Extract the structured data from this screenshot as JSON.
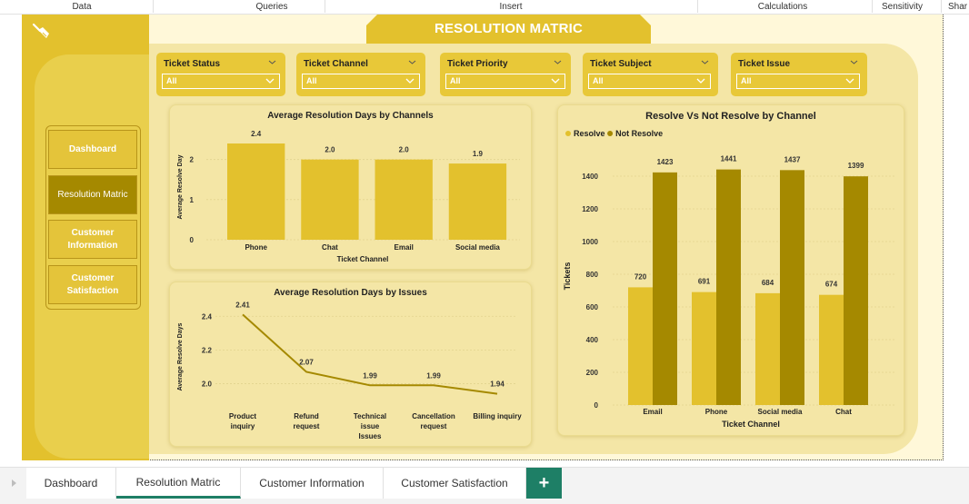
{
  "ribbon": {
    "items": [
      "Data",
      "Queries",
      "Insert",
      "Calculations",
      "Sensitivity",
      "Shar"
    ]
  },
  "page": {
    "title": "RESOLUTION MATRIC",
    "colors": {
      "gold": "#e3c12d",
      "dark_gold": "#a58900",
      "panel": "#f4e6a6",
      "accent_tab": "#1e7f66"
    }
  },
  "nav": {
    "items": [
      {
        "label": "Dashboard",
        "active": false
      },
      {
        "label": "Resolution Matric",
        "active": true
      },
      {
        "label": "Customer Information",
        "active": false
      },
      {
        "label": "Customer Satisfaction",
        "active": false
      }
    ]
  },
  "filters": [
    {
      "label": "Ticket Status",
      "value": "All"
    },
    {
      "label": "Ticket Channel",
      "value": "All"
    },
    {
      "label": "Ticket Priority",
      "value": "All"
    },
    {
      "label": "Ticket Subject",
      "value": "All"
    },
    {
      "label": "Ticket Issue",
      "value": "All"
    }
  ],
  "chart_data": [
    {
      "type": "bar",
      "title": "Average Resolution Days by Channels",
      "xlabel": "Ticket Channel",
      "ylabel": "Average Resolve Day",
      "categories": [
        "Phone",
        "Chat",
        "Email",
        "Social media"
      ],
      "values": [
        2.4,
        2.0,
        2.0,
        1.9
      ],
      "value_labels": [
        "2.4",
        "2.0",
        "2.0",
        "1.9"
      ],
      "yticks": [
        "0",
        "1",
        "2"
      ],
      "ylim": [
        0,
        2.4
      ],
      "color": "#e3c12d"
    },
    {
      "type": "line",
      "title": "Average Resolution Days by Issues",
      "xlabel": "",
      "ylabel": "Average Resolve Days",
      "categories": [
        "Product inquiry",
        "Refund request",
        "Technical issue Issues",
        "Cancellation request",
        "Billing inquiry"
      ],
      "category_lines": [
        [
          "Product",
          "inquiry"
        ],
        [
          "Refund",
          "request"
        ],
        [
          "Technical",
          "issue",
          "Issues"
        ],
        [
          "Cancellation",
          "request"
        ],
        [
          "Billing inquiry"
        ]
      ],
      "values": [
        2.41,
        2.07,
        1.99,
        1.99,
        1.94
      ],
      "value_labels": [
        "2.41",
        "2.07",
        "1.99",
        "1.99",
        "1.94"
      ],
      "yticks": [
        "2.0",
        "2.2",
        "2.4"
      ],
      "ylim": [
        1.9,
        2.45
      ],
      "color": "#a58900"
    },
    {
      "type": "bar",
      "title": "Resolve Vs Not Resolve by Channel",
      "xlabel": "Ticket Channel",
      "ylabel": "Tickets",
      "categories": [
        "Email",
        "Phone",
        "Social media",
        "Chat"
      ],
      "series": [
        {
          "name": "Resolve",
          "values": [
            720,
            691,
            684,
            674
          ],
          "color": "#e3c12d"
        },
        {
          "name": "Not Resolve",
          "values": [
            1423,
            1441,
            1437,
            1399
          ],
          "color": "#a58900"
        }
      ],
      "yticks": [
        "0",
        "200",
        "400",
        "600",
        "800",
        "1000",
        "1200",
        "1400"
      ],
      "ylim": [
        0,
        1500
      ],
      "legend": "top-left"
    }
  ],
  "tabs": {
    "items": [
      {
        "label": "Dashboard",
        "active": false
      },
      {
        "label": "Resolution Matric",
        "active": true
      },
      {
        "label": "Customer Information",
        "active": false
      },
      {
        "label": "Customer Satisfaction",
        "active": false
      }
    ],
    "add_label": "+"
  }
}
